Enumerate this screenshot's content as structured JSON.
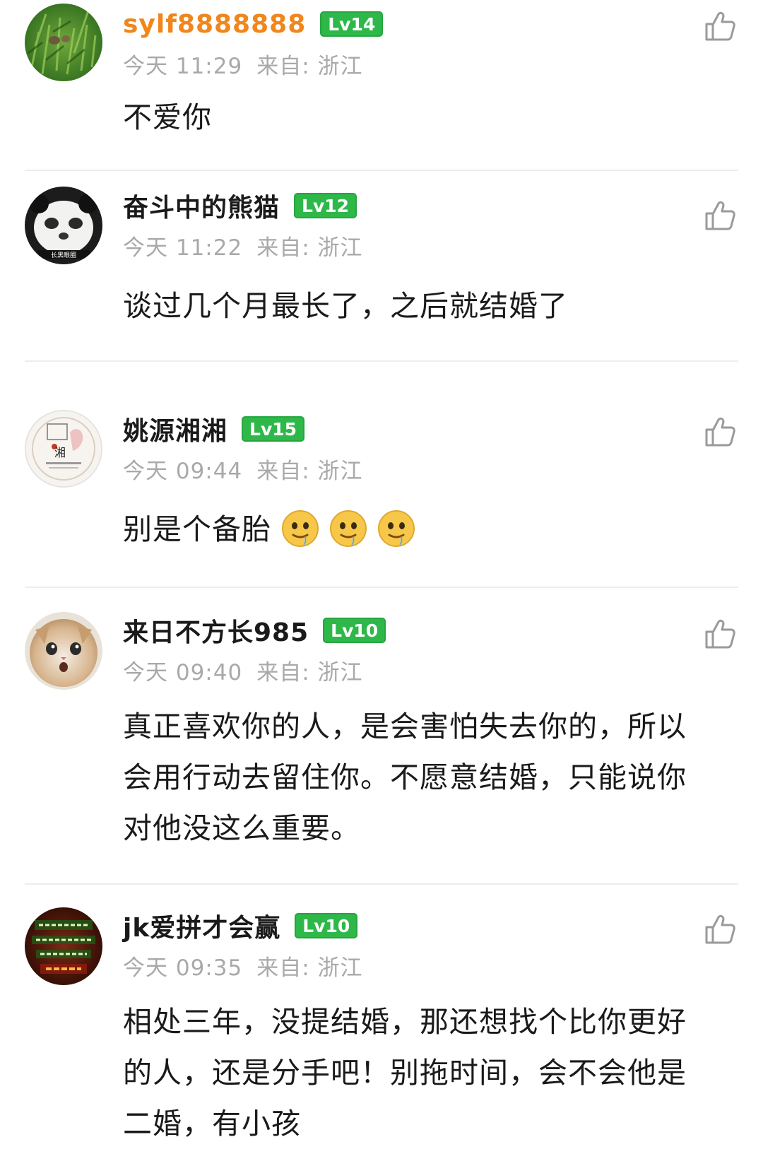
{
  "comments": [
    {
      "username": "sylf8888888",
      "level": "Lv14",
      "time": "今天 11:29",
      "location": "来自: 浙江",
      "content": "不爱你",
      "avatar": "grass-photo"
    },
    {
      "username": "奋斗中的熊猫",
      "level": "Lv12",
      "time": "今天 11:22",
      "location": "来自: 浙江",
      "content": "谈过几个月最长了，之后就结婚了",
      "avatar": "panda-photo"
    },
    {
      "username": "姚源湘湘",
      "level": "Lv15",
      "time": "今天 09:44",
      "location": "来自: 浙江",
      "content": "别是个备胎",
      "emojis": [
        "drooling-face-emoji",
        "drooling-face-emoji",
        "drooling-face-emoji"
      ],
      "avatar": "logo-badge"
    },
    {
      "username": "来日不方长985",
      "level": "Lv10",
      "time": "今天 09:40",
      "location": "来自: 浙江",
      "content_lines": [
        "真正喜欢你的人，是会害怕失去你的，所以",
        "会用行动去留住你。不愿意结婚，只能说你",
        "对他没这么重要。"
      ],
      "avatar": "cat-photo"
    },
    {
      "username": "jk爱拼才会赢",
      "level": "Lv10",
      "time": "今天 09:35",
      "location": "来自: 浙江",
      "content_lines": [
        "相处三年，没提结婚，那还想找个比你更好",
        "的人，还是分手吧！别拖时间，会不会他是",
        "二婚，有小孩"
      ],
      "avatar": "red-green-text-badge"
    }
  ],
  "icons": {
    "like": "thumbs-up-outline-icon"
  },
  "colors": {
    "vip_username": "#f0861c",
    "level_badge": "#2fb84a",
    "meta_text": "#a9a9a9",
    "divider": "#ededed"
  }
}
